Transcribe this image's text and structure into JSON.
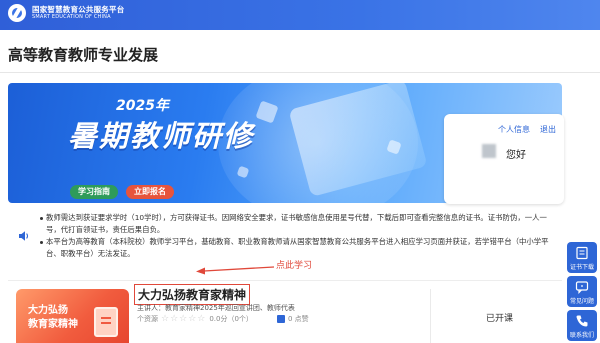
{
  "header": {
    "logo_cn": "国家智慧教育公共服务平台",
    "logo_en": "SMART EDUCATION OF CHINA"
  },
  "page": {
    "title": "高等教育教师专业发展"
  },
  "banner": {
    "year": "2025年",
    "title": "暑期教师研修",
    "guide_button": "学习指南",
    "signup_button": "立即报名"
  },
  "user": {
    "profile_link": "个人信息",
    "logout_link": "退出",
    "greeting": "您好"
  },
  "notice": {
    "items": [
      "教师需达到获证要求学时（10学时），方可获得证书。因网络安全要求，证书敏感信息使用星号代替，下载后即可查看完整信息的证书。证书防伪，一人一号，代打盲领证书，责任后果自负。",
      "本平台为高等教育（本科院校）教师学习平台，基础教育、职业教育教师请从国家智慧教育公共服务平台进入相应学习页面并获证，若学错平台（中小学平台、职教平台）无法发证。"
    ]
  },
  "hint": {
    "text": "点此学习",
    "color": "#e0483a"
  },
  "course": {
    "thumb_text_line1": "大力弘扬",
    "thumb_text_line2": "教育家精神",
    "title": "大力弘扬教育家精神",
    "meta": "主讲人：教育家精神2025年巡回宣讲团、教师代表",
    "resources": "个资源",
    "stars": "☆☆☆☆☆",
    "rating": "0.0分（0个）",
    "likes": "0 点赞",
    "status": "已开课"
  },
  "float_toolbar": {
    "items": [
      {
        "label": "证书下载",
        "icon": "certificate-icon"
      },
      {
        "label": "常见问题",
        "icon": "faq-icon"
      },
      {
        "label": "联系我们",
        "icon": "phone-icon"
      }
    ]
  },
  "colors": {
    "brand_blue": "#2e66d6",
    "accent_red": "#e0483a"
  }
}
